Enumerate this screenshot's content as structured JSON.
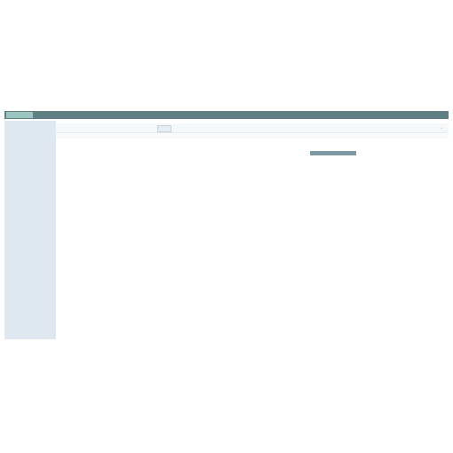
{
  "app": {
    "title": "",
    "user": ""
  },
  "toolbar": {
    "button_label": "",
    "left_text": "",
    "sub_text": ""
  },
  "sidebar": {
    "items": [
      {
        "label": ""
      },
      {
        "label": ""
      },
      {
        "label": ""
      },
      {
        "label": ""
      },
      {
        "label": ""
      },
      {
        "label": ""
      },
      {
        "label": ""
      }
    ]
  },
  "section": {
    "title": ""
  },
  "columns": [
    {
      "header": "",
      "value": ""
    },
    {
      "header": "",
      "value": ""
    },
    {
      "header": "",
      "value": ""
    },
    {
      "header": "",
      "value": ""
    },
    {
      "header": "",
      "value": ""
    },
    {
      "header": "",
      "value": ""
    }
  ],
  "footer": {
    "note": ""
  },
  "colors": {
    "topbar": "#5f7f83",
    "sidebar": "#dfe8f0",
    "section_header": "#7f99a4",
    "accent": "#9cc4c0"
  }
}
